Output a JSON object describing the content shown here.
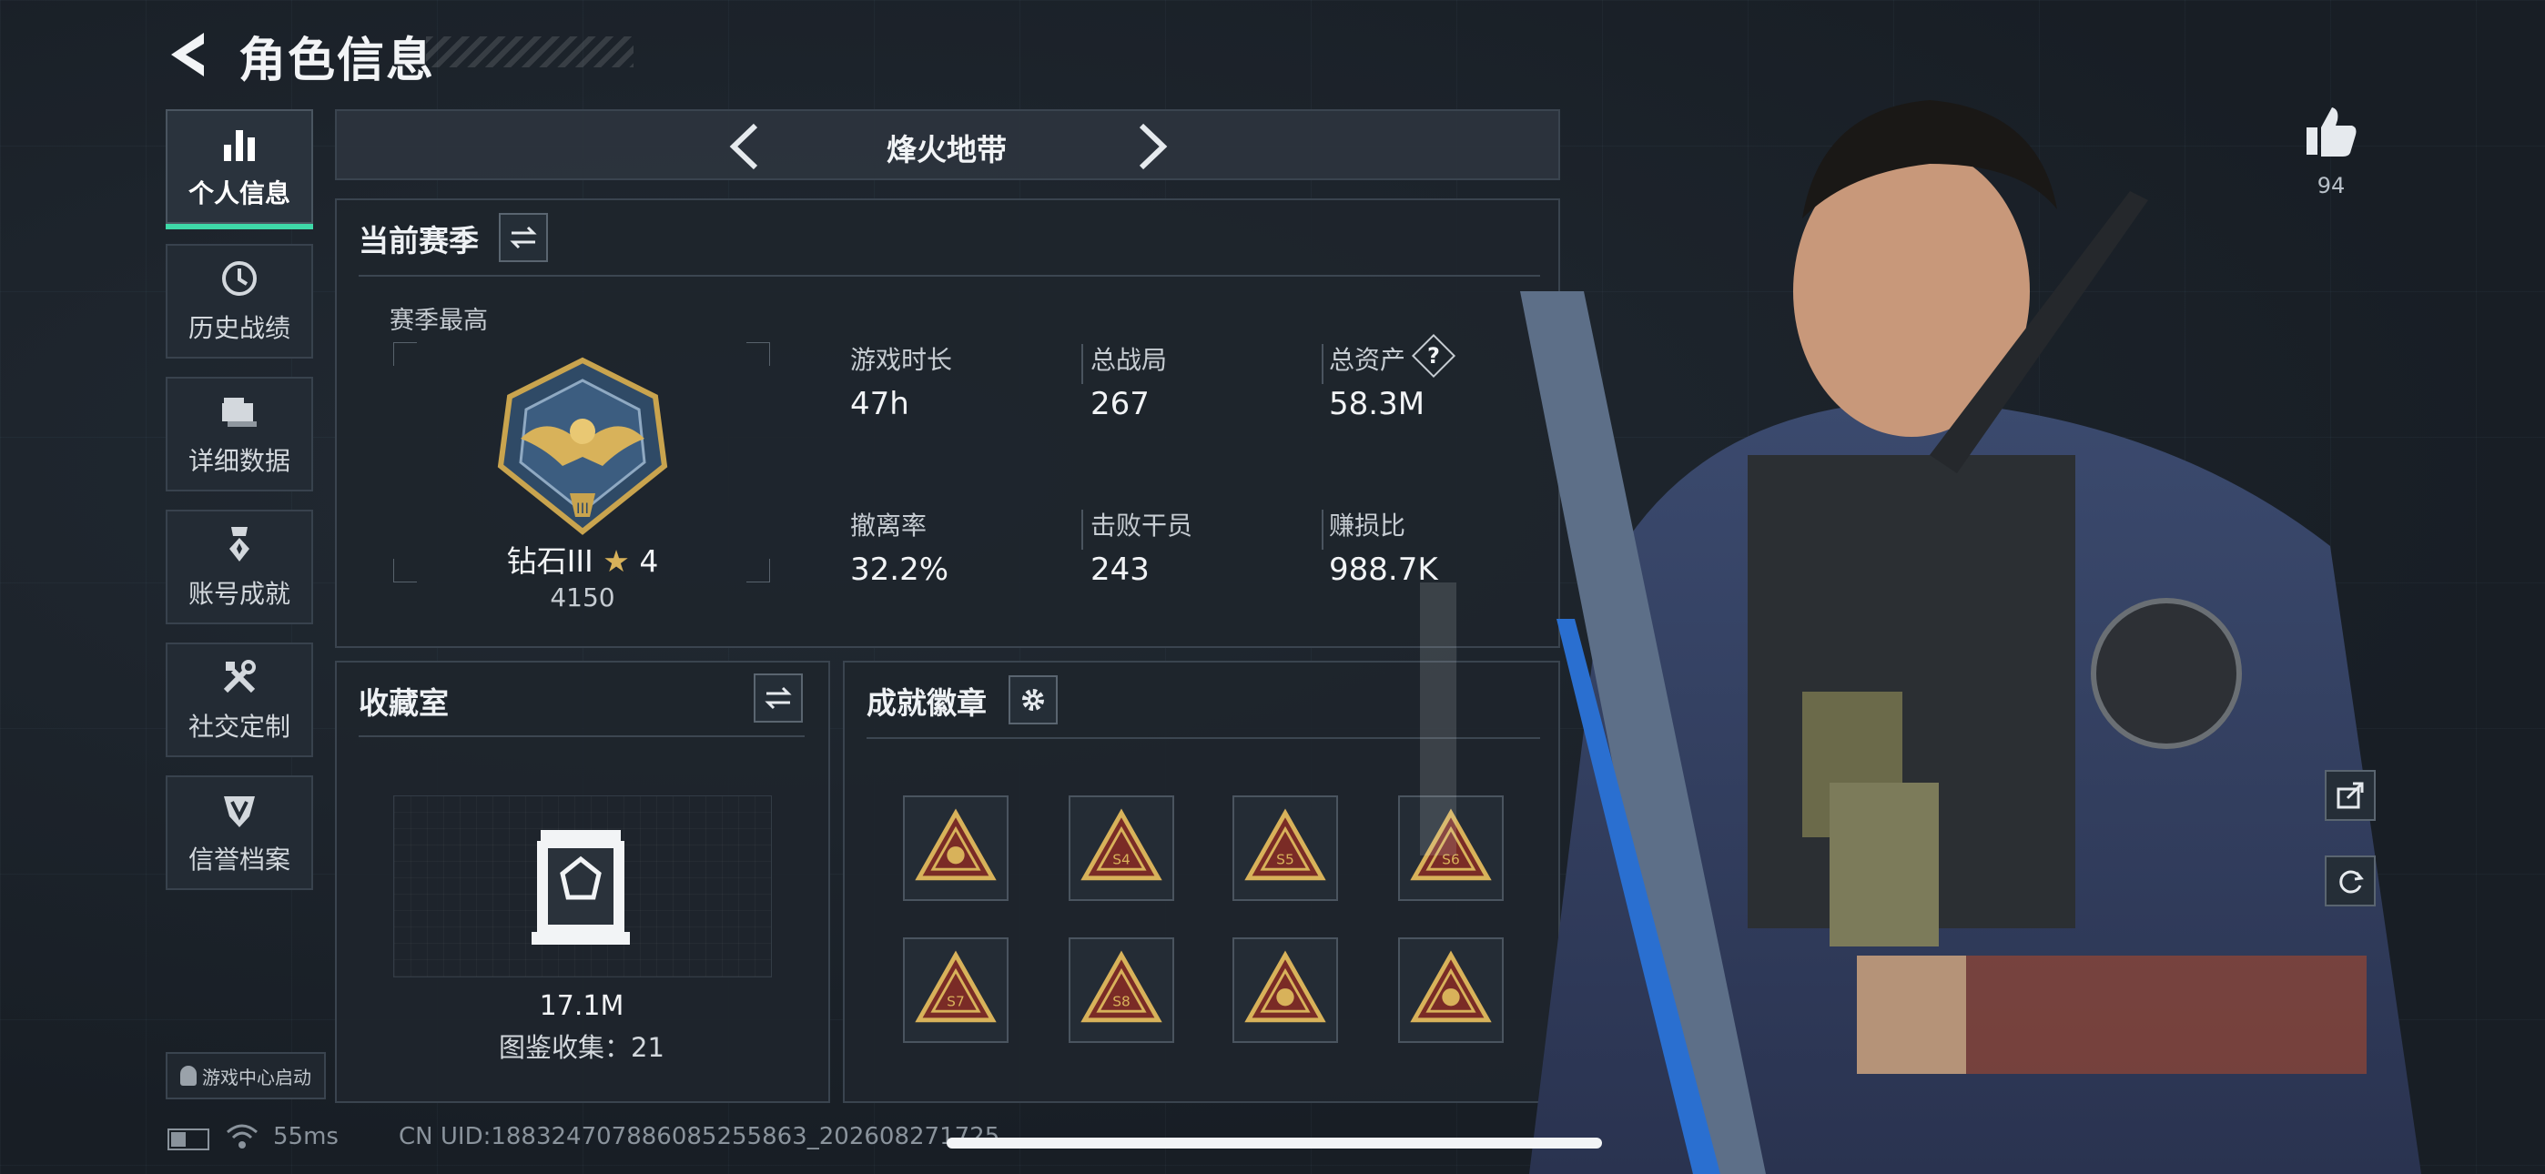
{
  "header": {
    "title": "角色信息"
  },
  "sidebar": {
    "items": [
      {
        "label": "个人信息",
        "icon": "bar-chart-icon",
        "active": true
      },
      {
        "label": "历史战绩",
        "icon": "history-clock-icon",
        "active": false
      },
      {
        "label": "详细数据",
        "icon": "folder-icon",
        "active": false
      },
      {
        "label": "账号成就",
        "icon": "medal-icon",
        "active": false
      },
      {
        "label": "社交定制",
        "icon": "tools-icon",
        "active": false
      },
      {
        "label": "信誉档案",
        "icon": "shield-v-icon",
        "active": false
      }
    ],
    "launch_label": "游戏中心启动"
  },
  "mode_bar": {
    "label": "烽火地带"
  },
  "season": {
    "title": "当前赛季",
    "highest_label": "赛季最高",
    "rank_name": "钻石III",
    "rank_stars": "4",
    "rank_score": "4150",
    "stats": [
      {
        "label": "游戏时长",
        "value": "47h"
      },
      {
        "label": "总战局",
        "value": "267"
      },
      {
        "label": "总资产",
        "value": "58.3M",
        "help": "?"
      },
      {
        "label": "撤离率",
        "value": "32.2%"
      },
      {
        "label": "击败干员",
        "value": "243"
      },
      {
        "label": "赚损比",
        "value": "988.7K"
      }
    ]
  },
  "collection": {
    "title": "收藏室",
    "value": "17.1M",
    "count_text": "图鉴收集：21"
  },
  "badges": {
    "title": "成就徽章",
    "items": [
      {
        "icon": "badge-globe-icon"
      },
      {
        "icon": "badge-s4-icon",
        "text": "S4"
      },
      {
        "icon": "badge-s5-icon",
        "text": "S5"
      },
      {
        "icon": "badge-s6-icon",
        "text": "S6"
      },
      {
        "icon": "badge-s7-icon",
        "text": "S7"
      },
      {
        "icon": "badge-s8-icon",
        "text": "S8"
      },
      {
        "icon": "badge-star-icon"
      },
      {
        "icon": "badge-rocket-icon"
      }
    ]
  },
  "likes": {
    "count": "94"
  },
  "status": {
    "ping": "55ms",
    "uid": "CN UID:1883247078860852558​63_202608271725"
  },
  "colors": {
    "accent": "#3ed9a8",
    "gold": "#d8b25a",
    "panel": "#1e252d"
  }
}
